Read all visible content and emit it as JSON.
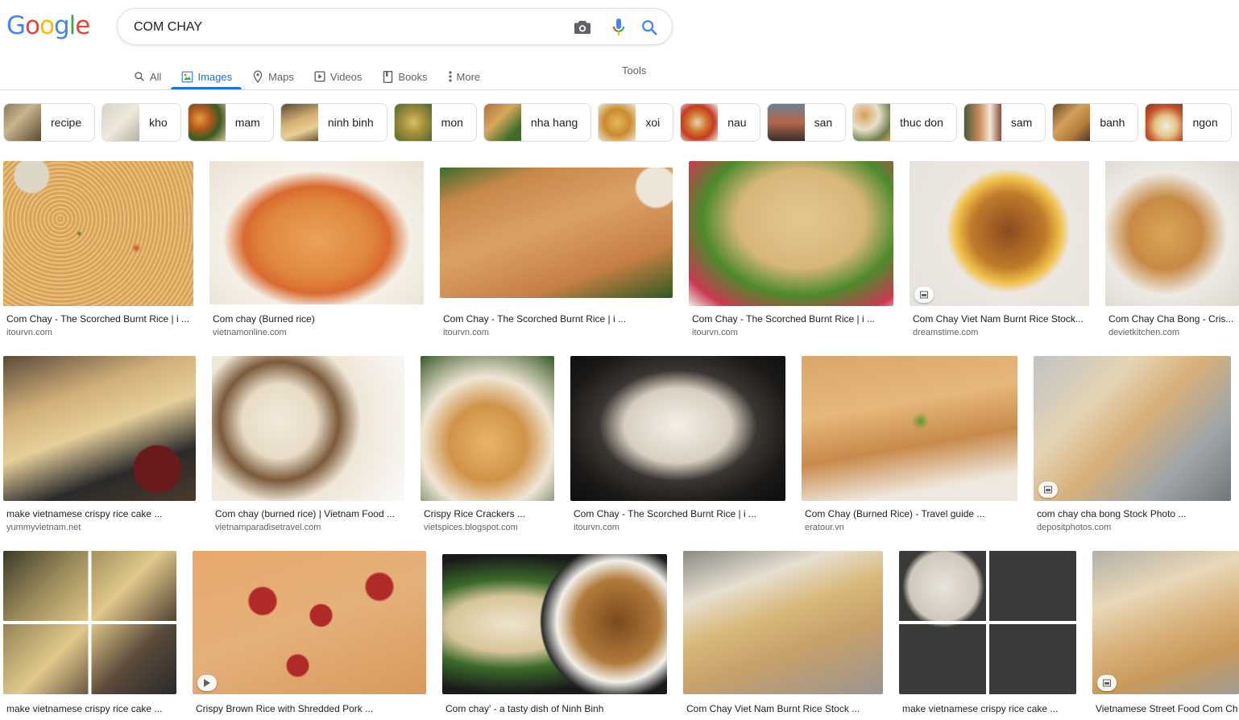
{
  "logo": "Google",
  "search": {
    "query": "COM CHAY"
  },
  "tabs": [
    {
      "label": "All",
      "icon": "search-icon"
    },
    {
      "label": "Images",
      "icon": "image-icon"
    },
    {
      "label": "Maps",
      "icon": "map-pin-icon"
    },
    {
      "label": "Videos",
      "icon": "play-icon"
    },
    {
      "label": "Books",
      "icon": "book-icon"
    },
    {
      "label": "More",
      "icon": "more-vert-icon"
    }
  ],
  "tools_label": "Tools",
  "chips": [
    {
      "label": "recipe"
    },
    {
      "label": "kho"
    },
    {
      "label": "mam"
    },
    {
      "label": "ninh binh"
    },
    {
      "label": "mon"
    },
    {
      "label": "nha hang"
    },
    {
      "label": "xoi"
    },
    {
      "label": "nau"
    },
    {
      "label": "san"
    },
    {
      "label": "thuc don"
    },
    {
      "label": "sam"
    },
    {
      "label": "banh"
    },
    {
      "label": "ngon"
    }
  ],
  "results": [
    {
      "title": "Com Chay - The Scorched Burnt Rice | i ...",
      "source": "itourvn.com"
    },
    {
      "title": "Com chay (Burned rice)",
      "source": "vietnamonline.com"
    },
    {
      "title": "Com Chay - The Scorched Burnt Rice | i ...",
      "source": "itourvn.com"
    },
    {
      "title": "Com Chay - The Scorched Burnt Rice | i ...",
      "source": "itourvn.com"
    },
    {
      "title": "Com Chay Viet Nam Burnt Rice Stock...",
      "source": "dreamstime.com"
    },
    {
      "title": "Com Chay Cha Bong - Cris...",
      "source": "devietkitchen.com"
    },
    {
      "title": "make vietnamese crispy rice cake ...",
      "source": "yummyvietnam.net"
    },
    {
      "title": "Com chay (burned rice) | Vietnam Food ...",
      "source": "vietnamparadisetravel.com"
    },
    {
      "title": "Crispy Rice Crackers ...",
      "source": "vietspices.blogspot.com"
    },
    {
      "title": "Com Chay - The Scorched Burnt Rice | i ...",
      "source": "itourvn.com"
    },
    {
      "title": "Com Chay (Burned Rice) - Travel guide ...",
      "source": "eratour.vn"
    },
    {
      "title": "com chay cha bong Stock Photo ...",
      "source": "depositphotos.com"
    },
    {
      "title": "make vietnamese crispy rice cake ...",
      "source": ""
    },
    {
      "title": "Crispy Brown Rice with Shredded Pork ...",
      "source": ""
    },
    {
      "title": "Com chay' - a tasty dish of Ninh Binh",
      "source": ""
    },
    {
      "title": "Com Chay Viet Nam Burnt Rice Stock ...",
      "source": ""
    },
    {
      "title": "make vietnamese crispy rice cake ...",
      "source": ""
    },
    {
      "title": "Vietnamese Street Food Com Ch",
      "source": ""
    }
  ],
  "colors": {
    "blue": "#4285F4",
    "red": "#EA4335",
    "yellow": "#FBBC05",
    "green": "#34A853",
    "accent": "#1a73e8",
    "muted": "#5f6368"
  }
}
